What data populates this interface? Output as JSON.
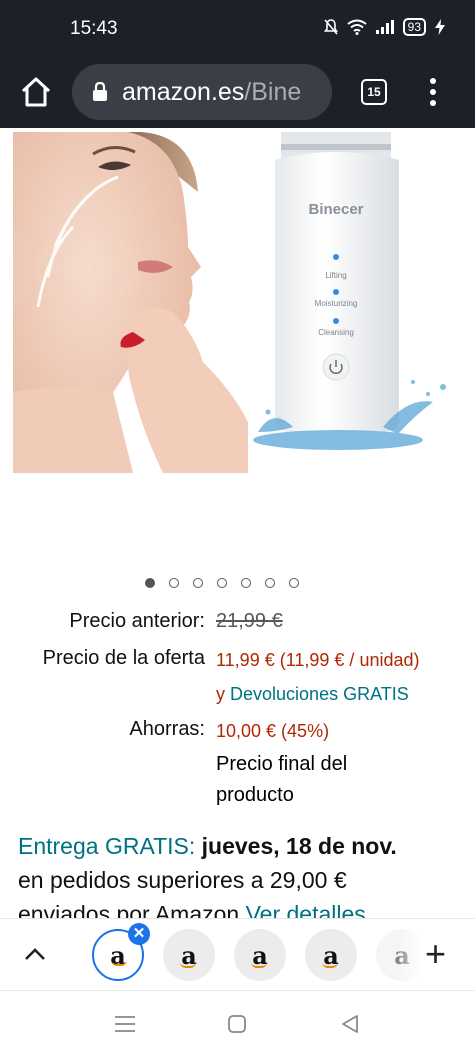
{
  "status_bar": {
    "time": "15:43",
    "battery": "93"
  },
  "browser": {
    "url_domain": "amazon.es",
    "url_path": "/Bine",
    "tab_count": "15"
  },
  "product": {
    "brand_on_device": "Binecer",
    "device_modes": [
      "Lifting",
      "Moisturizing",
      "Cleansing"
    ],
    "image_count": 7,
    "active_image": 1
  },
  "pricing": {
    "previous_label": "Precio anterior:",
    "previous_value": "21,99 €",
    "offer_label": "Precio de la oferta",
    "offer_value": "11,99 € (11,99 € / unidad)",
    "returns_prefix": "y",
    "returns_link": "Devoluciones GRATIS",
    "savings_label": "Ahorras:",
    "savings_value": "10,00 € (45%)",
    "final_line1": "Precio final del",
    "final_line2": "producto"
  },
  "delivery": {
    "free_label": "Entrega GRATIS:",
    "date": "jueves, 18 de nov.",
    "line2": "en pedidos superiores a 29,00 €",
    "line3_prefix": "enviados por Amazon",
    "details_link": "Ver detalles"
  },
  "tab_strip": {
    "tab_letter": "a",
    "add_label": "+"
  }
}
